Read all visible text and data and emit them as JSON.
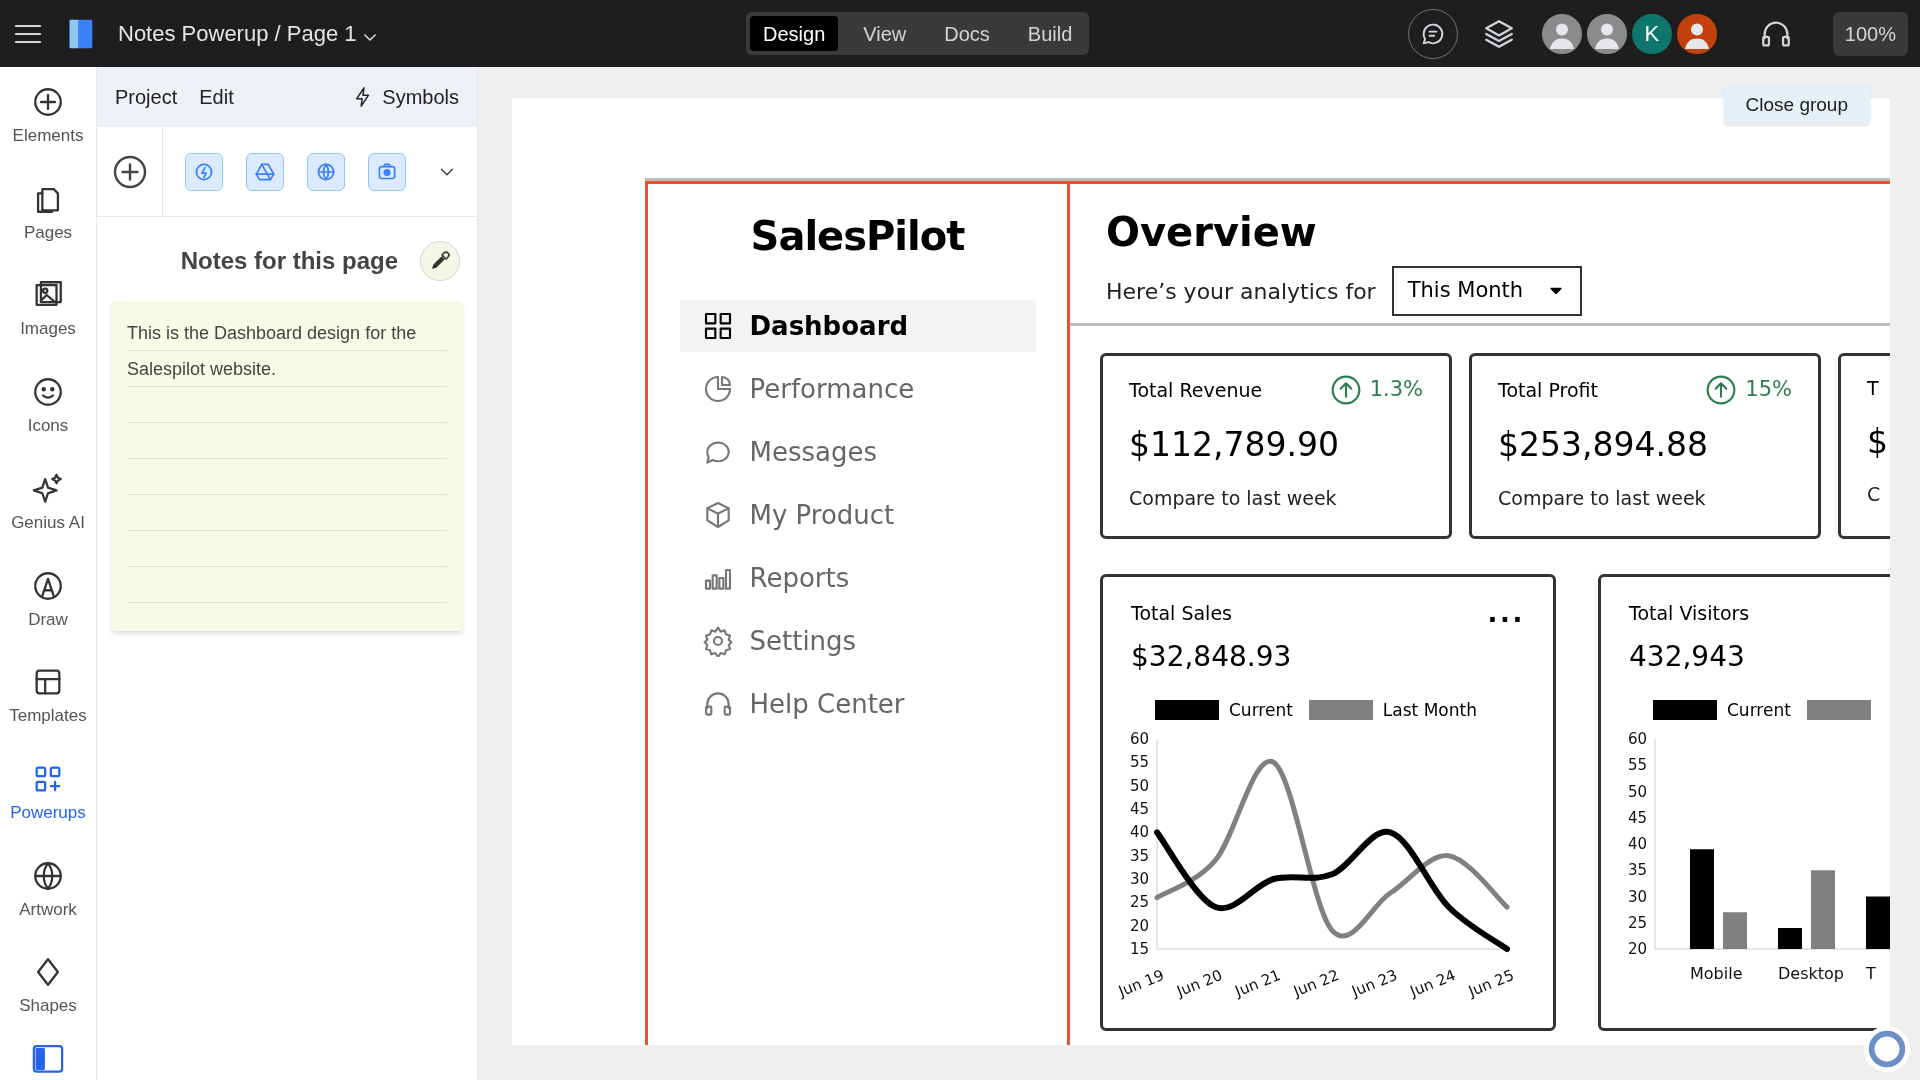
{
  "top_bar": {
    "title": "Notes Powerup / Page 1",
    "modes": [
      {
        "label": "Design",
        "selected": true
      },
      {
        "label": "View",
        "selected": false
      },
      {
        "label": "Docs",
        "selected": false
      },
      {
        "label": "Build",
        "selected": false
      }
    ],
    "avatars": [
      {
        "kind": "photo"
      },
      {
        "kind": "photo"
      },
      {
        "kind": "letter",
        "initial": "K"
      },
      {
        "kind": "photo"
      }
    ],
    "zoom": "100%"
  },
  "rail": [
    {
      "label": "Elements",
      "selected": false
    },
    {
      "label": "Pages",
      "selected": false
    },
    {
      "label": "Images",
      "selected": false
    },
    {
      "label": "Icons",
      "selected": false
    },
    {
      "label": "Genius AI",
      "selected": false
    },
    {
      "label": "Draw",
      "selected": false
    },
    {
      "label": "Templates",
      "selected": false
    },
    {
      "label": "Powerups",
      "selected": true
    },
    {
      "label": "Artwork",
      "selected": false
    },
    {
      "label": "Shapes",
      "selected": false
    }
  ],
  "panel": {
    "menu": [
      "Project",
      "Edit"
    ],
    "symbols": "Symbols",
    "notes_title": "Notes for this page",
    "note": "This is the Dashboard design for the Salespilot website."
  },
  "canvas": {
    "close_group": "Close group",
    "design": {
      "logo": "SalesPilot",
      "nav": [
        {
          "label": "Dashboard",
          "selected": true
        },
        {
          "label": "Performance",
          "selected": false
        },
        {
          "label": "Messages",
          "selected": false
        },
        {
          "label": "My Product",
          "selected": false
        },
        {
          "label": "Reports",
          "selected": false
        },
        {
          "label": "Settings",
          "selected": false
        },
        {
          "label": "Help Center",
          "selected": false
        }
      ],
      "heading": "Overview",
      "subtitle": "Here’s your analytics for",
      "period": "This Month",
      "cards": [
        {
          "title": "Total Revenue",
          "change": "1.3%",
          "value": "$112,789.90",
          "caption": "Compare to last week"
        },
        {
          "title": "Total Profit",
          "change": "15%",
          "value": "$253,894.88",
          "caption": "Compare to last week"
        },
        {
          "title": "T",
          "value": "$",
          "caption": "C"
        }
      ],
      "sales": {
        "title": "Total Sales",
        "value": "$32,848.93",
        "menu": "...",
        "chart_data": {
          "type": "line",
          "categories": [
            "Jun 19",
            "Jun 20",
            "Jun 21",
            "Jun 22",
            "Jun 23",
            "Jun 24",
            "Jun 25"
          ],
          "ylim": [
            15,
            60
          ],
          "yticks": [
            15,
            20,
            25,
            30,
            35,
            40,
            45,
            50,
            55,
            60
          ],
          "series": [
            {
              "name": "Current",
              "color": "#000000",
              "values": [
                40,
                24,
                30,
                31,
                40,
                24,
                15
              ]
            },
            {
              "name": "Last Month",
              "color": "#808080",
              "values": [
                26,
                34,
                55,
                19,
                27,
                35,
                24
              ]
            }
          ]
        }
      },
      "visitors": {
        "title": "Total Visitors",
        "value": "432,943",
        "chart_data": {
          "type": "bar",
          "categories": [
            "Mobile",
            "Desktop",
            "T"
          ],
          "ylim": [
            20,
            60
          ],
          "yticks": [
            20,
            25,
            30,
            35,
            40,
            45,
            50,
            55,
            60
          ],
          "series": [
            {
              "name": "Current",
              "color": "#000000",
              "values": [
                39,
                24,
                30
              ]
            },
            {
              "color": "#808080",
              "values": [
                27,
                35,
                null
              ]
            }
          ]
        }
      }
    }
  }
}
